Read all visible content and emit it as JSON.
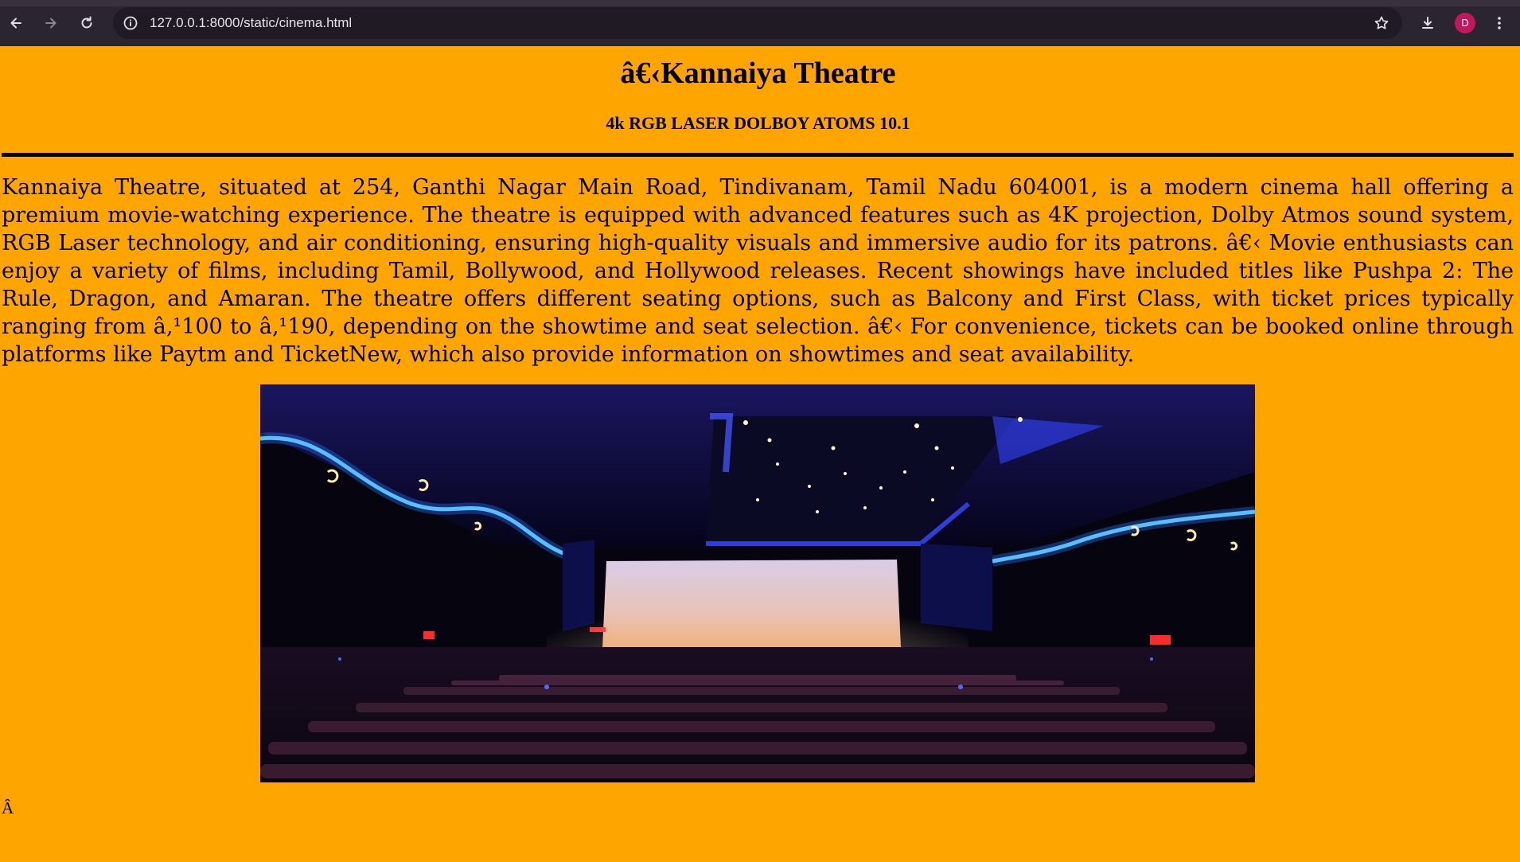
{
  "browser": {
    "url": "127.0.0.1:8000/static/cinema.html",
    "profile_initial": "D",
    "icons": {
      "back": "arrow-left-icon",
      "forward": "arrow-right-icon",
      "reload": "reload-icon",
      "site_info": "info-icon",
      "bookmark": "star-icon",
      "downloads": "download-icon",
      "menu": "kebab-menu-icon"
    }
  },
  "page": {
    "title": "â€‹Kannaiya Theatre",
    "subtitle": "4k RGB LASER DOLBOY ATOMS 10.1",
    "description": "Kannaiya Theatre, situated at 254, Ganthi Nagar Main Road, Tindivanam, Tamil Nadu 604001, is a modern cinema hall offering a premium movie-watching experience. The theatre is equipped with advanced features such as 4K projection, Dolby Atmos sound system, RGB Laser technology, and air conditioning, ensuring high-quality visuals and immersive audio for its patrons. â€‹ Movie enthusiasts can enjoy a variety of films, including Tamil, Bollywood, and Hollywood releases. Recent showings have included titles like Pushpa 2: The Rule, Dragon, and Amaran. The theatre offers different seating options, such as Balcony and First Class, with ticket prices typically ranging from â‚¹100 to â‚¹190, depending on the showtime and seat selection. â€‹ For convenience, tickets can be booked online through platforms like Paytm and TicketNew, which also provide information on showtimes and seat availability.",
    "stray_text": "Â",
    "background_color": "#FFA500"
  }
}
